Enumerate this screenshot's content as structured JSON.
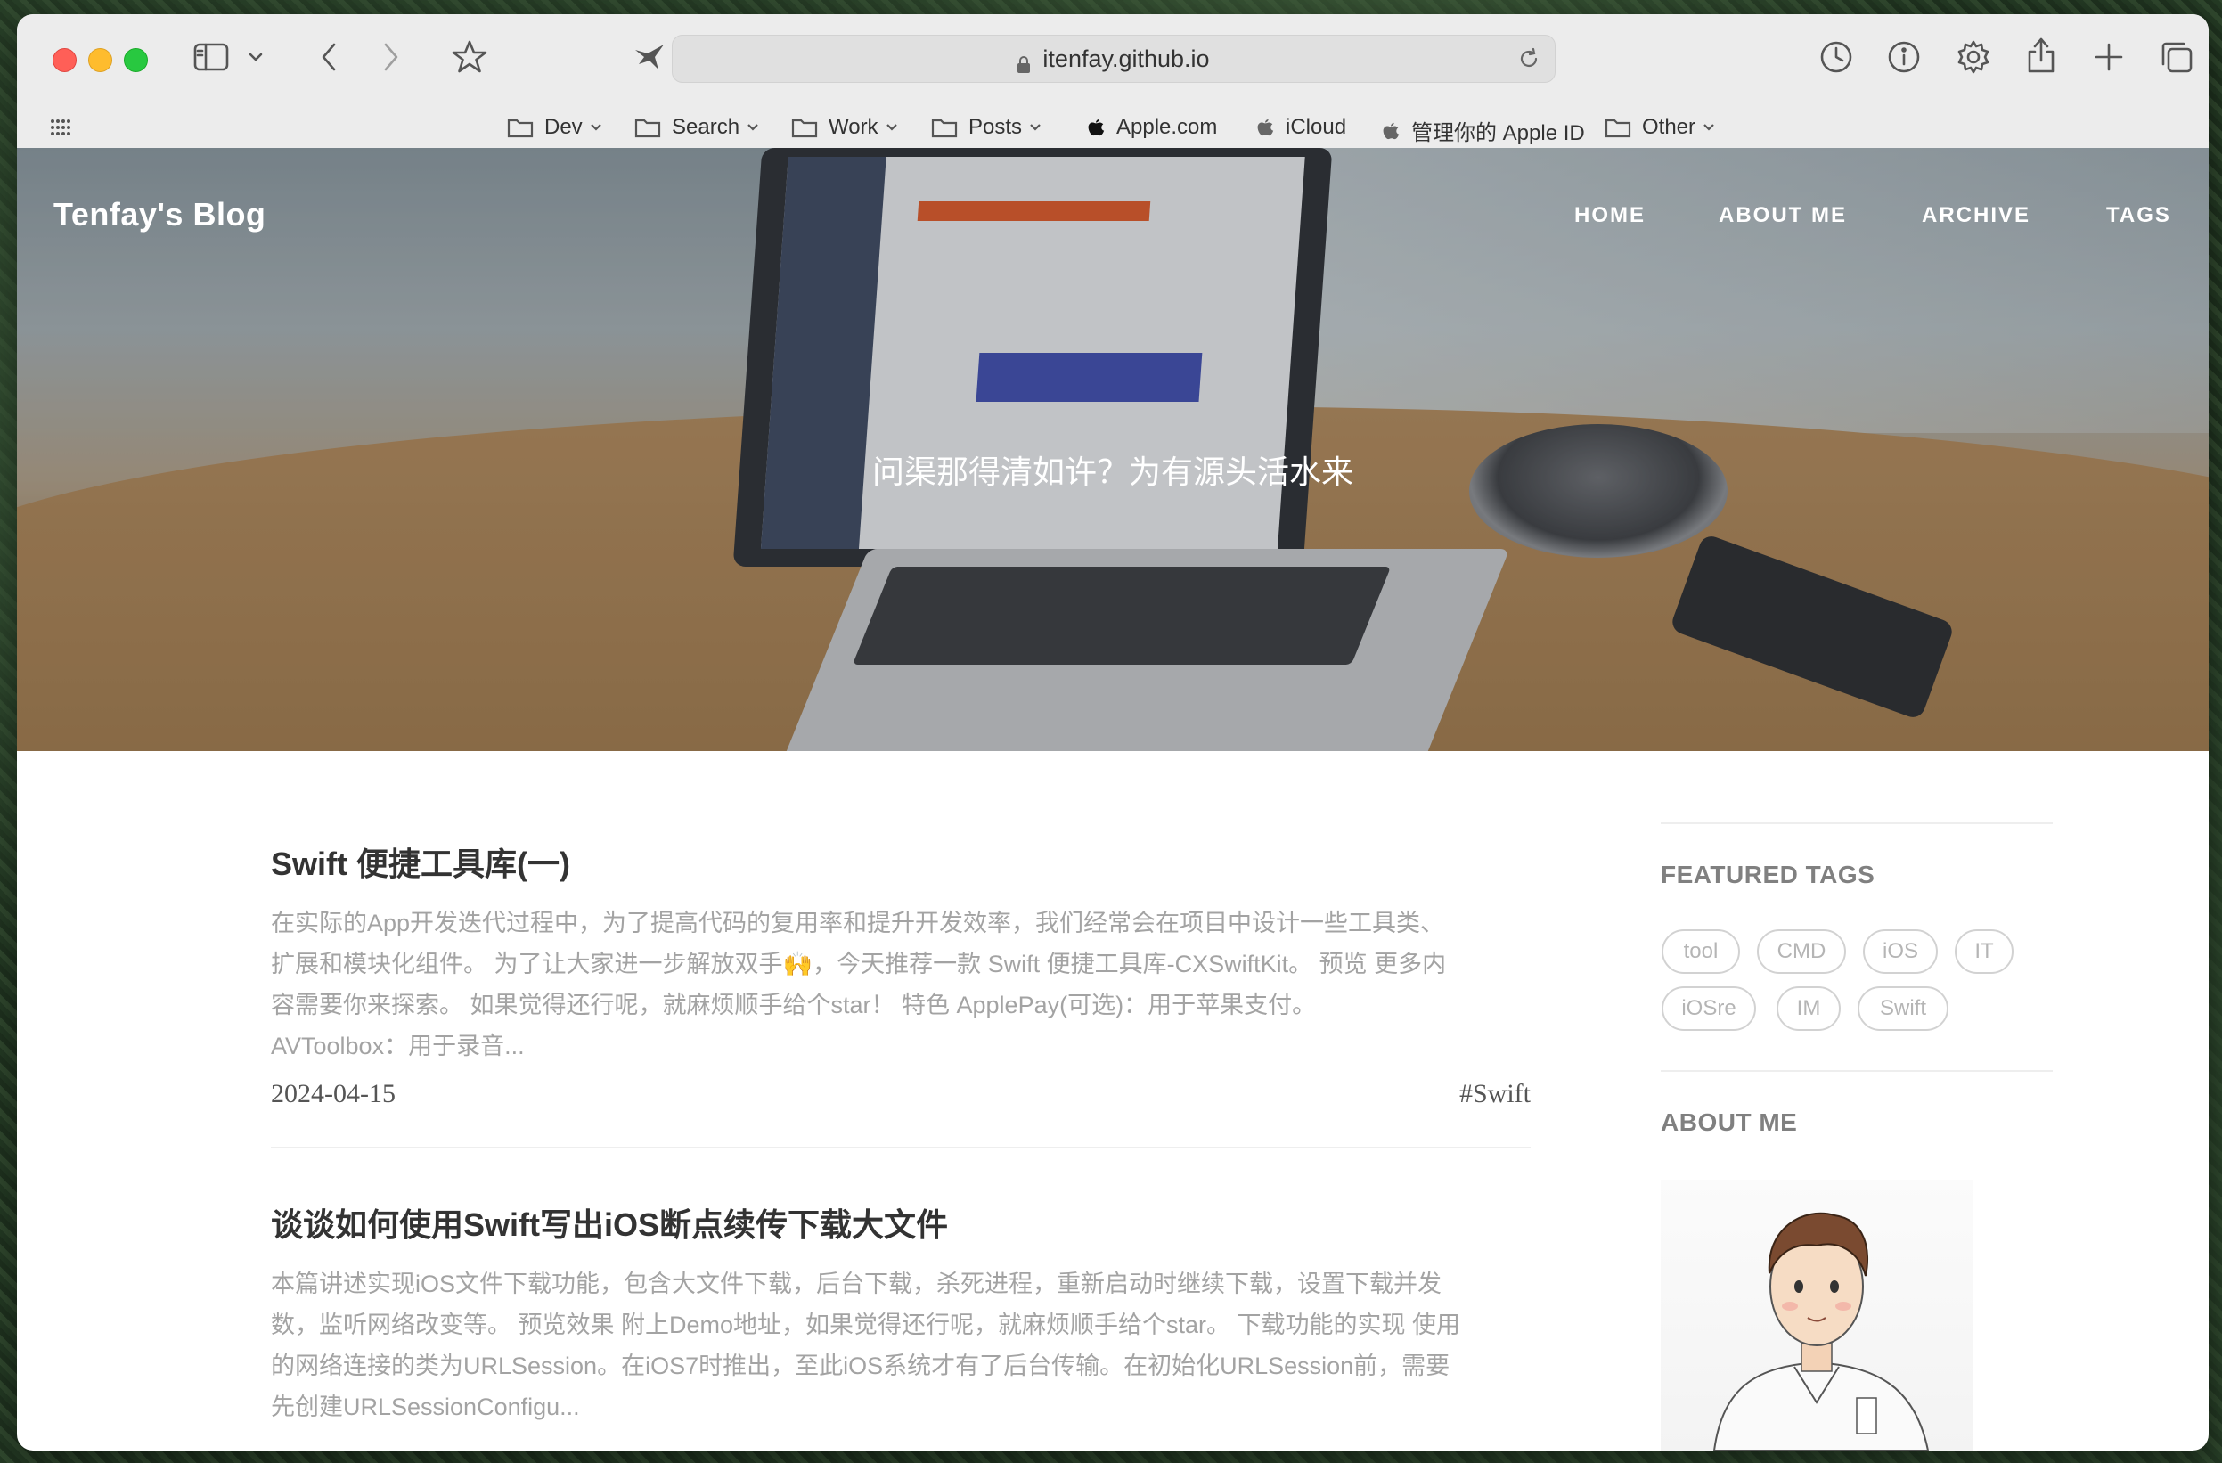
{
  "browser": {
    "url": "itenfay.github.io",
    "bookmarks": [
      {
        "label": "Dev",
        "type": "folder"
      },
      {
        "label": "Search",
        "type": "folder"
      },
      {
        "label": "Work",
        "type": "folder"
      },
      {
        "label": "Posts",
        "type": "folder"
      },
      {
        "label": "Apple.com",
        "type": "apple"
      },
      {
        "label": "iCloud",
        "type": "apple"
      },
      {
        "label": "管理你的 Apple ID",
        "type": "apple"
      },
      {
        "label": "Other",
        "type": "folder"
      }
    ]
  },
  "site": {
    "brand": "Tenfay's Blog",
    "nav": [
      "HOME",
      "ABOUT ME",
      "ARCHIVE",
      "TAGS"
    ],
    "tagline": "问渠那得清如许？为有源头活水来"
  },
  "posts": [
    {
      "title": "Swift 便捷工具库(一)",
      "excerpt": [
        "在实际的App开发迭代过程中，为了提高代码的复用率和提升开发效率，我们经常会在项目中设计一些工具类、",
        "扩展和模块化组件。 为了让大家进一步解放双手🙌，今天推荐一款 Swift 便捷工具库-CXSwiftKit。 预览 更多内",
        "容需要你来探索。 如果觉得还行呢，就麻烦顺手给个star！ 特色 ApplePay(可选)：用于苹果支付。",
        "AVToolbox：用于录音..."
      ],
      "date": "2024-04-15",
      "tag": "#Swift"
    },
    {
      "title": "谈谈如何使用Swift写出iOS断点续传下载大文件",
      "excerpt": [
        "本篇讲述实现iOS文件下载功能，包含大文件下载，后台下载，杀死进程，重新启动时继续下载，设置下载并发",
        "数，监听网络改变等。 预览效果 附上Demo地址，如果觉得还行呢，就麻烦顺手给个star。 下载功能的实现 使用",
        "的网络连接的类为URLSession。在iOS7时推出，至此iOS系统才有了后台传输。在初始化URLSession前，需要",
        "先创建URLSessionConfigu..."
      ]
    }
  ],
  "sidebar": {
    "featured_title": "FEATURED TAGS",
    "tags": [
      "tool",
      "CMD",
      "iOS",
      "IT",
      "iOSre",
      "IM",
      "Swift"
    ],
    "about_title": "ABOUT ME"
  }
}
